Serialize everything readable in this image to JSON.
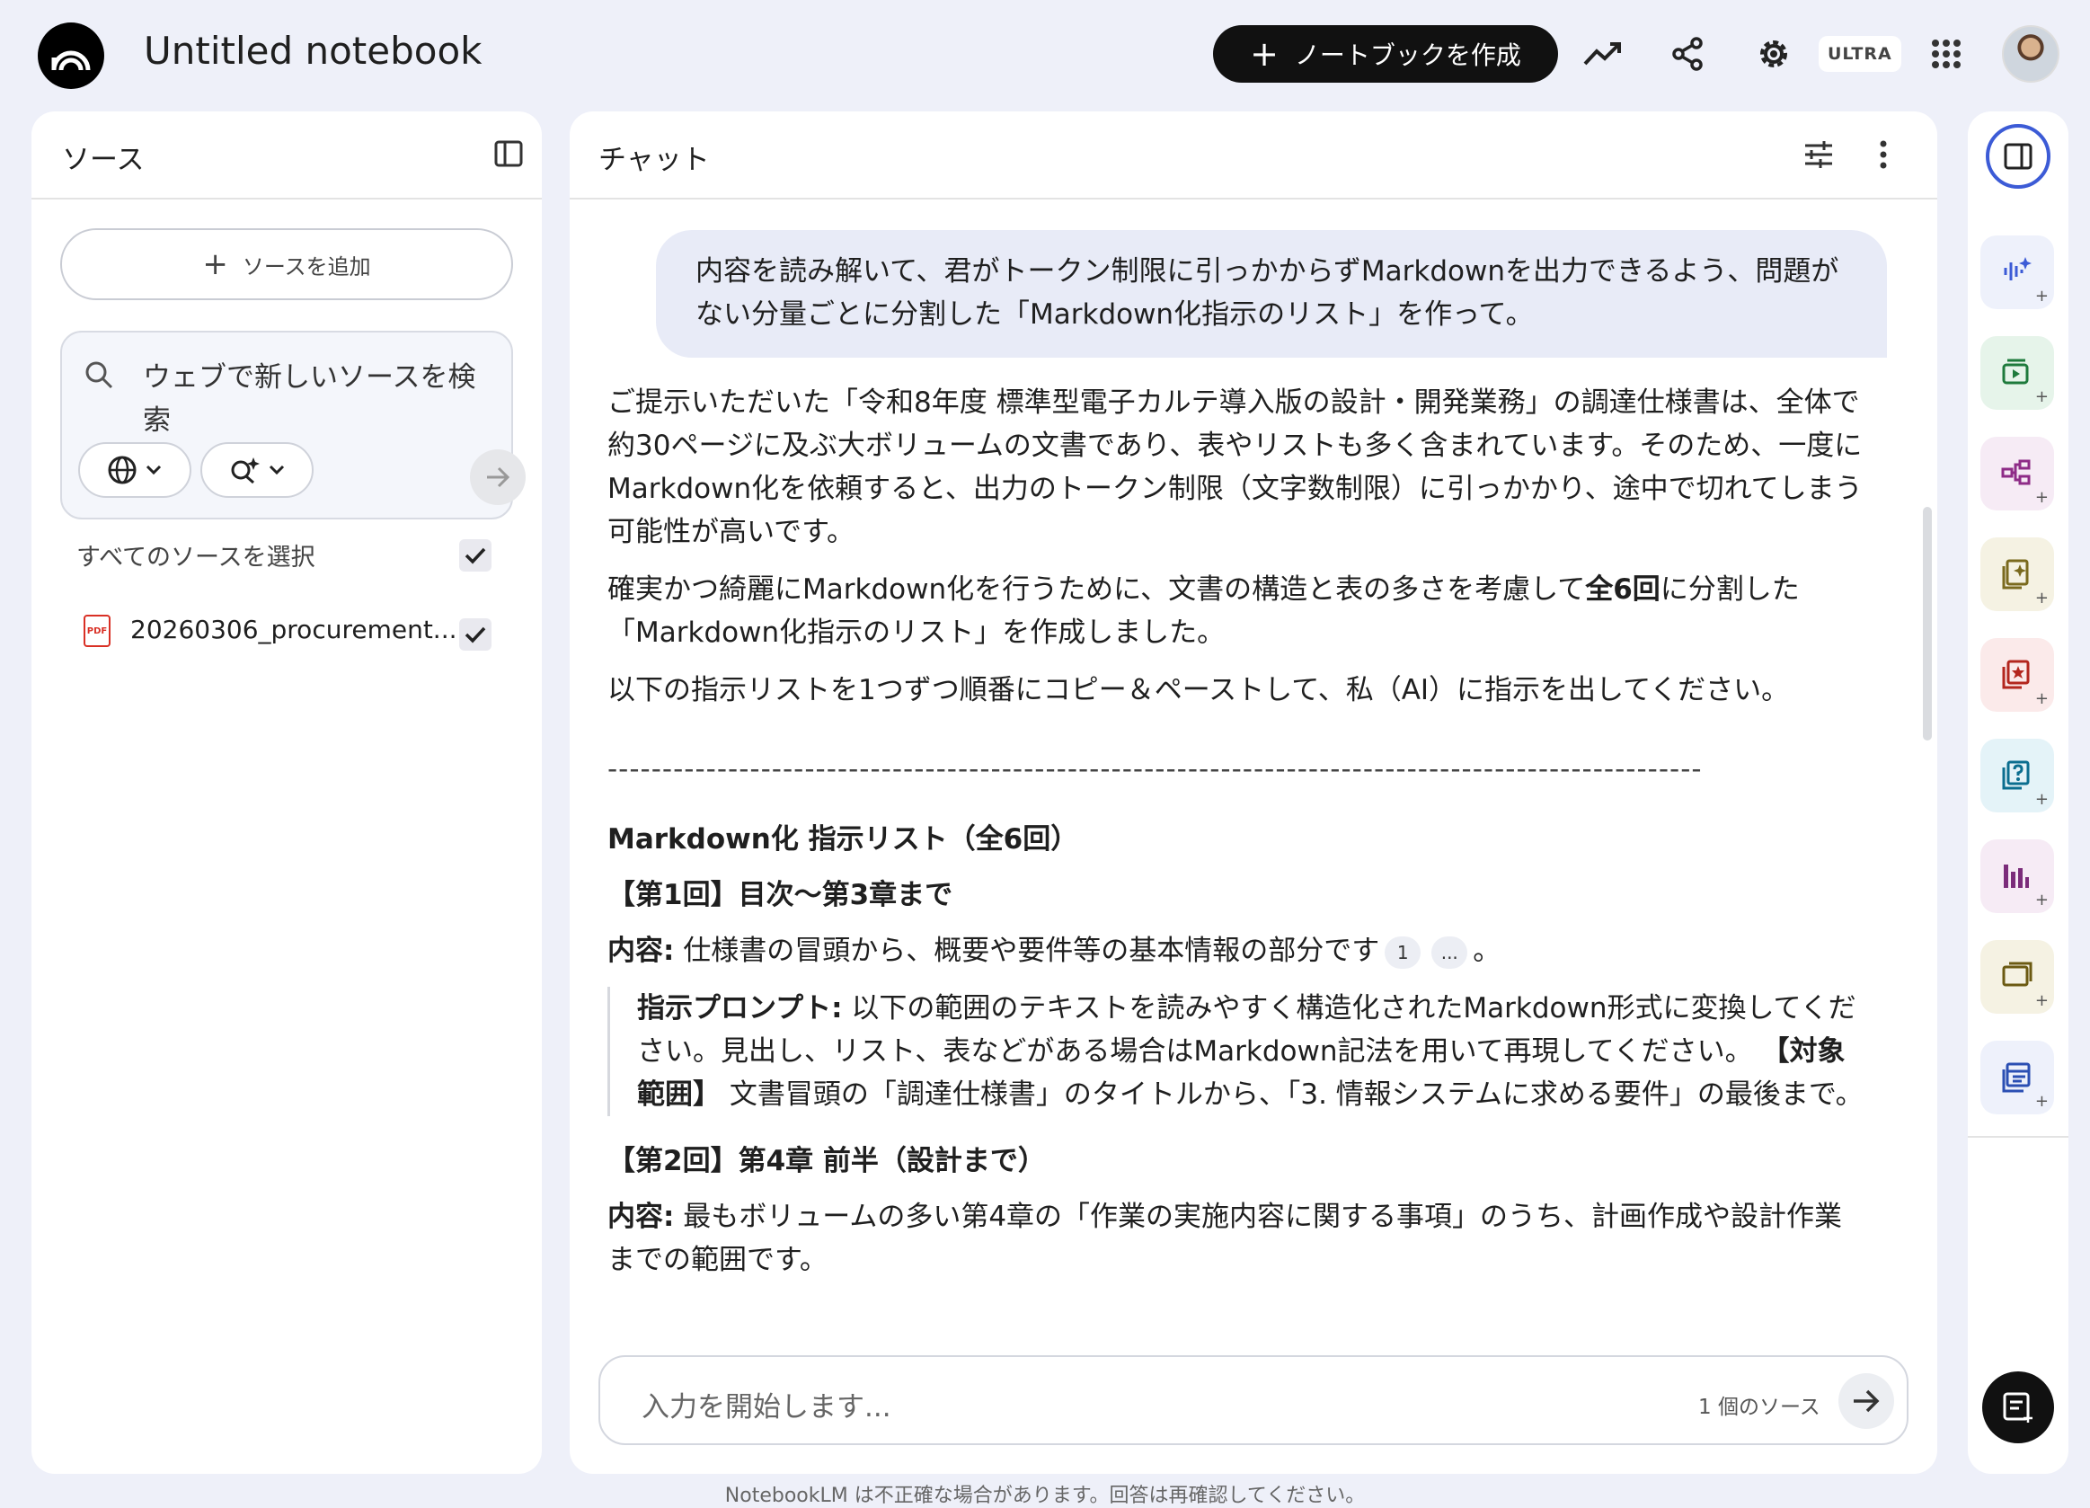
{
  "header": {
    "title": "Untitled notebook",
    "create_label": "ノートブックを作成",
    "plan_badge": "ULTRA"
  },
  "sources": {
    "title": "ソース",
    "add_label": "ソースを追加",
    "search_text": "ウェブで新しいソースを検索",
    "select_all": "すべてのソースを選択",
    "items": [
      {
        "name": "20260306_procurement...",
        "type": "PDF",
        "checked": true
      }
    ]
  },
  "chat": {
    "title": "チャット",
    "user_message": "内容を読み解いて、君がトークン制限に引っかからずMarkdownを出力できるよう、問題がない分量ごとに分割した「Markdown化指示のリスト」を作って。",
    "reply": {
      "p1": "ご提示いただいた「令和8年度 標準型電子カルテ導入版の設計・開発業務」の調達仕様書は、全体で約30ページに及ぶ大ボリュームの文書であり、表やリストも多く含まれています。そのため、一度にMarkdown化を依頼すると、出力のトークン制限（文字数制限）に引っかかり、途中で切れてしまう可能性が高いです。",
      "p2_before": "確実かつ綺麗にMarkdown化を行うために、文書の構造と表の多さを考慮して",
      "p2_bold": "全6回",
      "p2_after": "に分割した「Markdown化指示のリスト」を作成しました。",
      "p3": "以下の指示リストを1つずつ順番にコピー＆ペーストして、私（AI）に指示を出してください。",
      "rule": "----------------------------------------------------------------------------------------------------",
      "list_heading": "Markdown化 指示リスト（全6回）",
      "s1_heading": "【第1回】目次〜第3章まで",
      "s1_content_label": "内容:",
      "s1_content": " 仕様書の冒頭から、概要や要件等の基本情報の部分です",
      "s1_cite1": "1",
      "s1_cite2": "...",
      "s1_content_end": "。",
      "s1_prompt_label": "指示プロンプト:",
      "s1_prompt": " 以下の範囲のテキストを読みやすく構造化されたMarkdown形式に変換してください。見出し、リスト、表などがある場合はMarkdown記法を用いて再現してください。",
      "s1_range_label": "【対象範囲】",
      "s1_range": " 文書冒頭の「調達仕様書」のタイトルから、「3. 情報システムに求める要件」の最後まで。",
      "s2_heading": "【第2回】第4章 前半（設計まで）",
      "s2_content_label": "内容:",
      "s2_content": " 最もボリュームの多い第4章の「作業の実施内容に関する事項」のうち、計画作成や設計作業までの範囲です。"
    },
    "input_placeholder": "入力を開始します...",
    "source_count": "1 個のソース",
    "disclaimer": "NotebookLM は不正確な場合があります。回答は再確認してください。"
  },
  "colors": {
    "accent": "#3c5bd6",
    "background": "#eef0f9",
    "bubble": "#e8ebf7"
  },
  "studio_tools": [
    {
      "icon": "audio-overview-icon",
      "color": "#3c5bd6",
      "bg": "#eef1fb"
    },
    {
      "icon": "video-overview-icon",
      "color": "#1e7a3c",
      "bg": "#e6f4ea"
    },
    {
      "icon": "mind-map-icon",
      "color": "#8e2c87",
      "bg": "#f6ebf5"
    },
    {
      "icon": "report-icon",
      "color": "#7a6a1e",
      "bg": "#f5f2e3"
    },
    {
      "icon": "flashcards-icon",
      "color": "#b3261e",
      "bg": "#fbeaea"
    },
    {
      "icon": "quiz-icon",
      "color": "#0b6e8f",
      "bg": "#e4f3f8"
    },
    {
      "icon": "infographic-icon",
      "color": "#7b2c7a",
      "bg": "#f6ebf5"
    },
    {
      "icon": "slides-icon",
      "color": "#6b5a12",
      "bg": "#f5f2e3"
    },
    {
      "icon": "data-table-icon",
      "color": "#2b4fb3",
      "bg": "#eef1fb"
    }
  ]
}
